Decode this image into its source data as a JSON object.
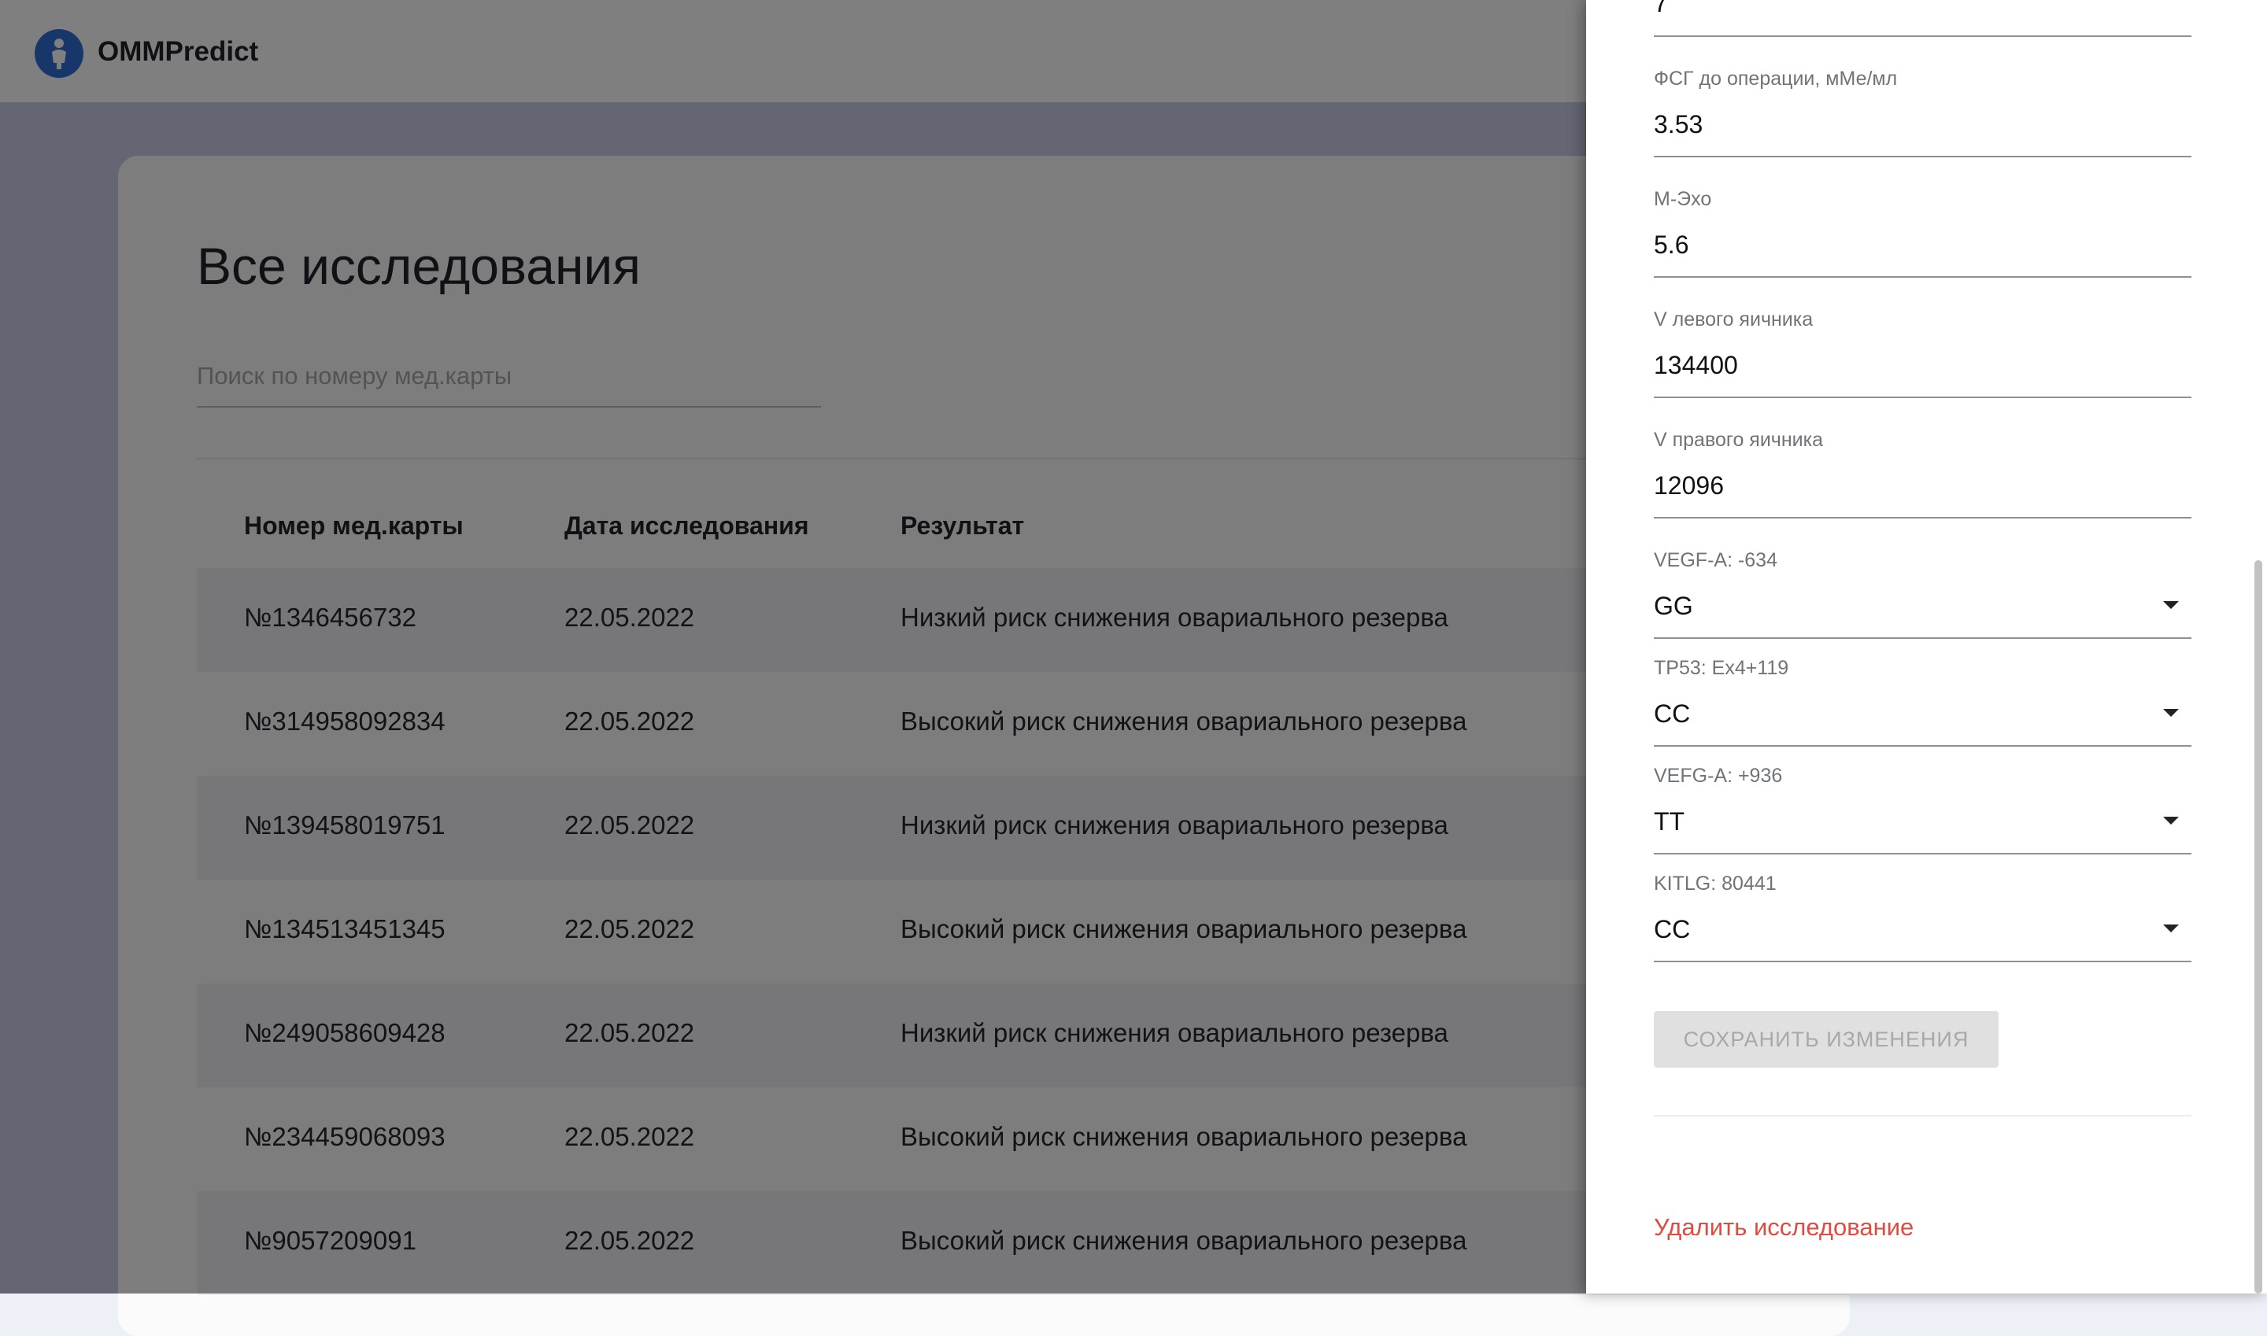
{
  "header": {
    "brand": "OMMPredict"
  },
  "main": {
    "title": "Все исследования",
    "search_placeholder": "Поиск по номеру мед.карты",
    "table": {
      "columns": [
        "Номер мед.карты",
        "Дата исследования",
        "Результат"
      ],
      "rows": [
        [
          "№1346456732",
          "22.05.2022",
          "Низкий риск снижения овариального резерва"
        ],
        [
          "№314958092834",
          "22.05.2022",
          "Высокий риск снижения овариального резерва"
        ],
        [
          "№139458019751",
          "22.05.2022",
          "Низкий риск снижения овариального резерва"
        ],
        [
          "№134513451345",
          "22.05.2022",
          "Высокий риск снижения овариального резерва"
        ],
        [
          "№249058609428",
          "22.05.2022",
          "Низкий риск снижения овариального резерва"
        ],
        [
          "№234459068093",
          "22.05.2022",
          "Высокий риск снижения овариального резерва"
        ],
        [
          "№9057209091",
          "22.05.2022",
          "Высокий риск снижения овариального резерва"
        ]
      ]
    }
  },
  "drawer": {
    "top_partial_value": "7",
    "fields": [
      {
        "label": "ФСГ до операции, мМе/мл",
        "value": "3.53"
      },
      {
        "label": "М-Эхо",
        "value": "5.6"
      },
      {
        "label": "V левого яичника",
        "value": "134400"
      },
      {
        "label": "V правого яичника",
        "value": "12096"
      }
    ],
    "selects": [
      {
        "label": "VEGF-A: -634",
        "value": "GG"
      },
      {
        "label": "TP53: Ex4+119",
        "value": "CC"
      },
      {
        "label": "VEFG-A: +936",
        "value": "TT"
      },
      {
        "label": "KITLG: 80441",
        "value": "CC"
      }
    ],
    "save_label": "Сохранить изменения",
    "delete_label": "Удалить исследование"
  },
  "colors": {
    "accent": "#2f6fd6",
    "danger": "#e04b41",
    "overlay": "rgba(0,0,0,0.5)"
  }
}
